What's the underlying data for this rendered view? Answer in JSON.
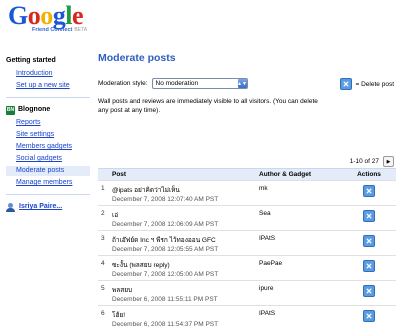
{
  "logo": {
    "letters": [
      {
        "ch": "G",
        "color": "#1a57d6"
      },
      {
        "ch": "o",
        "color": "#d8281e"
      },
      {
        "ch": "o",
        "color": "#f0b400"
      },
      {
        "ch": "g",
        "color": "#1a57d6"
      },
      {
        "ch": "l",
        "color": "#1e9b3a"
      },
      {
        "ch": "e",
        "color": "#d8281e"
      }
    ],
    "subtitle": "Friend Connect",
    "badge": "BETA"
  },
  "sidebar": {
    "getting_started": "Getting started",
    "introduction": "Introduction",
    "setup_new_site": "Set up a new site",
    "site_icon_text": "BN",
    "site_name": "Blognone",
    "reports": "Reports",
    "site_settings": "Site settings",
    "members_gadgets": "Members gadgets",
    "social_gadgets": "Social gadgets",
    "moderate_posts": "Moderate posts",
    "manage_members": "Manage members",
    "user_name": "Isriya Paire..."
  },
  "main": {
    "title": "Moderate posts",
    "moderation_label": "Moderation style:",
    "moderation_value": "No moderation",
    "legend_text": "= Delete post",
    "description": "Wall posts and reviews are immediately visible to all visitors. (You can delete any post at any time).",
    "pager_text": "1-10 of 27",
    "columns": {
      "post": "Post",
      "author": "Author & Gadget",
      "actions": "Actions"
    },
    "posts": [
      {
        "num": "1",
        "text": "@ipats อย่าคิดว่าไม่เห็น",
        "date": "December 7, 2008 12:07:40 AM PST",
        "author": "mk"
      },
      {
        "num": "2",
        "text": "เอ่",
        "date": "December 7, 2008 12:06:09 AM PST",
        "author": "Sea"
      },
      {
        "num": "3",
        "text": "ถ้าเอ๊ฟย์ด Inc ฯ พีรก ไว้ทองออน GFC",
        "date": "December 7, 2008 12:05:55 AM PST",
        "author": "IPAtS"
      },
      {
        "num": "4",
        "text": "ซะงั้น (พลสยบ reply)",
        "date": "December 7, 2008 12:05:00 AM PST",
        "author": "PaePae"
      },
      {
        "num": "5",
        "text": "พลสยบ",
        "date": "December 6, 2008 11:55:11 PM PST",
        "author": "ipure"
      },
      {
        "num": "6",
        "text": "โฮ้ย!",
        "date": "December 6, 2008 11:54:37 PM PST",
        "author": "IPAtS"
      }
    ]
  }
}
